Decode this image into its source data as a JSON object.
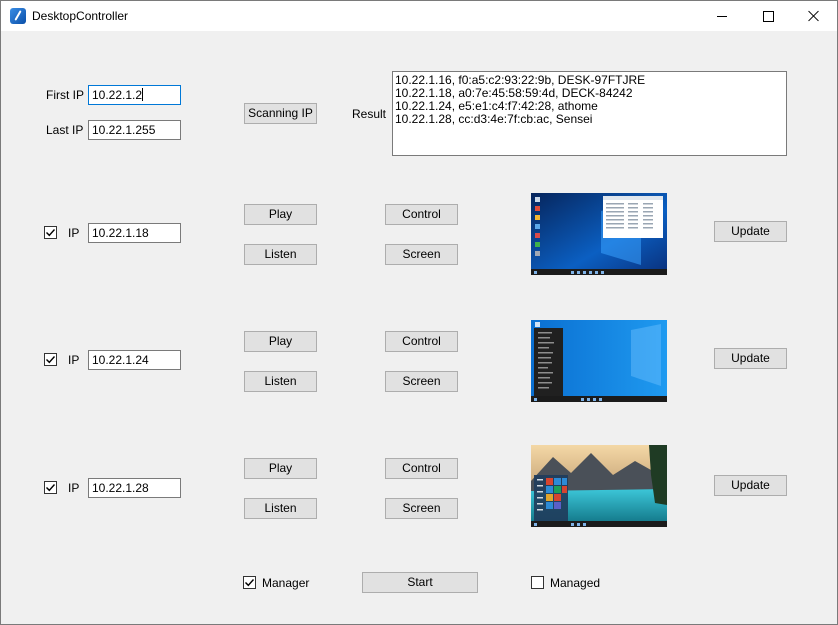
{
  "window": {
    "title": "DesktopController",
    "icon": "app-icon"
  },
  "scan": {
    "first_ip_label": "First IP",
    "first_ip_value": "10.22.1.2",
    "last_ip_label": "Last IP",
    "last_ip_value": "10.22.1.255",
    "scan_button": "Scanning IP",
    "result_label": "Result",
    "results": [
      "10.22.1.16, f0:a5:c2:93:22:9b, DESK-97FTJRE",
      "10.22.1.18, a0:7e:45:58:59:4d, DECK-84242",
      "10.22.1.24, e5:e1:c4:f7:42:28, athome",
      "10.22.1.28, cc:d3:4e:7f:cb:ac, Sensei"
    ]
  },
  "clients": [
    {
      "checked": true,
      "ip_label": "IP",
      "ip_value": "10.22.1.18",
      "play": "Play",
      "listen": "Listen",
      "control": "Control",
      "screen": "Screen",
      "update": "Update"
    },
    {
      "checked": true,
      "ip_label": "IP",
      "ip_value": "10.22.1.24",
      "play": "Play",
      "listen": "Listen",
      "control": "Control",
      "screen": "Screen",
      "update": "Update"
    },
    {
      "checked": true,
      "ip_label": "IP",
      "ip_value": "10.22.1.28",
      "play": "Play",
      "listen": "Listen",
      "control": "Control",
      "screen": "Screen",
      "update": "Update"
    }
  ],
  "footer": {
    "manager_label": "Manager",
    "manager_checked": true,
    "start_button": "Start",
    "managed_label": "Managed",
    "managed_checked": false
  },
  "colors": {
    "accent": "#0078d7",
    "button_bg": "#e1e1e1",
    "desktop_blue": "#0a6fd1"
  }
}
